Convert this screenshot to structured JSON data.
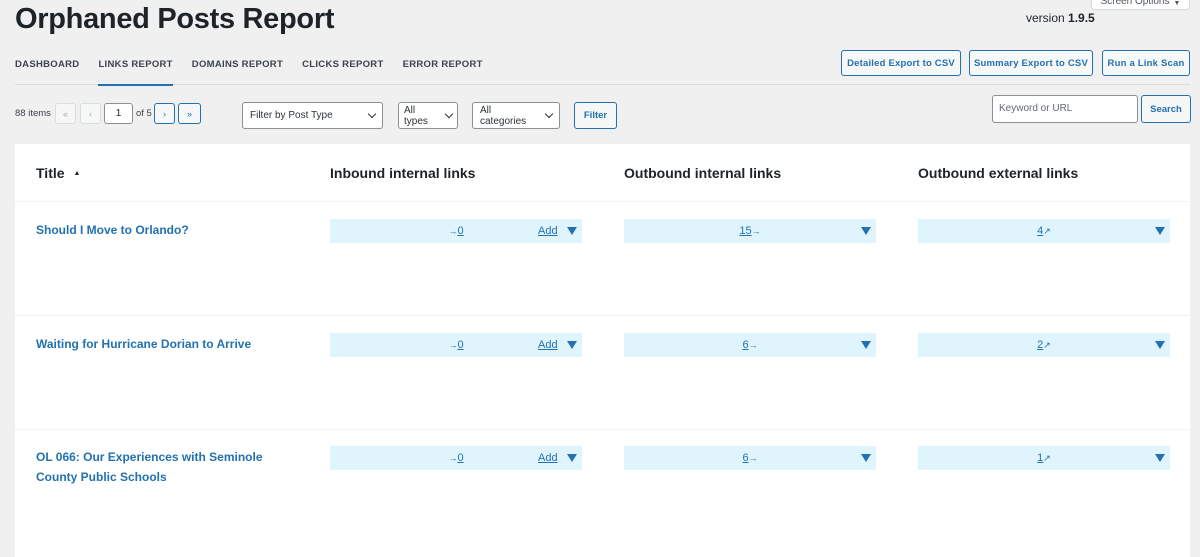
{
  "header": {
    "title": "Orphaned Posts Report",
    "version_label": "version",
    "version_number": "1.9.5",
    "screen_options": "Screen Options"
  },
  "nav": {
    "tabs": [
      {
        "label": "DASHBOARD",
        "active": false
      },
      {
        "label": "LINKS REPORT",
        "active": true
      },
      {
        "label": "DOMAINS REPORT",
        "active": false
      },
      {
        "label": "CLICKS REPORT",
        "active": false
      },
      {
        "label": "ERROR REPORT",
        "active": false
      }
    ]
  },
  "actions": {
    "detailed_export": "Detailed Export to CSV",
    "summary_export": "Summary Export to CSV",
    "run_scan": "Run a Link Scan"
  },
  "pagination": {
    "items_count": "88 items",
    "first": "«",
    "prev": "‹",
    "current_page": "1",
    "of_pages": "of 5",
    "next": "›",
    "last": "»"
  },
  "filters": {
    "post_type": "Filter by Post Type",
    "types": "All types",
    "categories": "All categories",
    "filter_button": "Filter"
  },
  "search": {
    "placeholder": "Keyword or URL",
    "button": "Search"
  },
  "table": {
    "columns": {
      "title": "Title",
      "title_sort": "▲",
      "inbound_internal": "Inbound internal links",
      "outbound_internal": "Outbound internal links",
      "outbound_external": "Outbound external links"
    },
    "add_label": "Add",
    "rows": [
      {
        "title": "Should I Move to Orlando?",
        "inbound_internal": "0",
        "outbound_internal": "15",
        "outbound_external": "4"
      },
      {
        "title": "Waiting for Hurricane Dorian to Arrive",
        "inbound_internal": "0",
        "outbound_internal": "6",
        "outbound_external": "2"
      },
      {
        "title": "OL 066: Our Experiences with Seminole County Public Schools",
        "inbound_internal": "0",
        "outbound_internal": "6",
        "outbound_external": "1"
      }
    ]
  },
  "icons": {
    "inbound_arrow": "→",
    "outbound_arrow": "→",
    "external_arrow": "↗"
  },
  "colors": {
    "accent": "#2271b1",
    "cell_background": "#dff4fc",
    "page_background": "#f0f0f1"
  }
}
